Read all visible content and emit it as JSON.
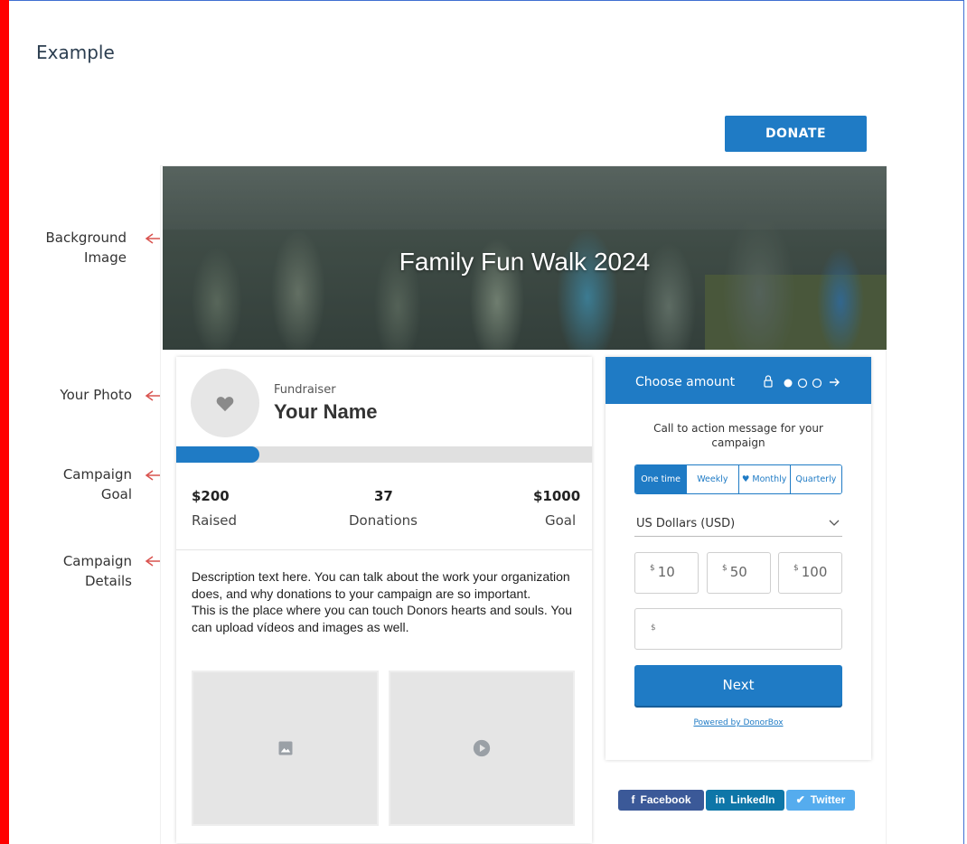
{
  "heading": "Example",
  "annotations": {
    "background_image": [
      "Background",
      "Image"
    ],
    "your_photo": [
      "Your Photo"
    ],
    "campaign_goal": [
      "Campaign",
      "Goal"
    ],
    "campaign_details": [
      "Campaign",
      "Details"
    ]
  },
  "topbar": {
    "donate_label": "DONATE"
  },
  "hero": {
    "title": "Family Fun Walk 2024"
  },
  "profile": {
    "role": "Fundraiser",
    "name": "Your Name",
    "progress_fraction": 0.2
  },
  "stats": [
    {
      "value": "$200",
      "label": "Raised"
    },
    {
      "value": "37",
      "label": "Donations"
    },
    {
      "value": "$1000",
      "label": "Goal"
    }
  ],
  "description": {
    "paragraph1": "Description text here. You can talk about the work your organization does, and why donations to your campaign are so important.",
    "paragraph2": "This is the place where you can touch Donors hearts and souls. You can upload vídeos and images as well."
  },
  "donation_form": {
    "header": "Choose amount",
    "cta": "Call to action message for your campaign",
    "frequencies": [
      "One time",
      "Weekly",
      "Monthly",
      "Quarterly"
    ],
    "active_frequency": "One time",
    "currency": "US Dollars (USD)",
    "currency_symbol": "$",
    "amounts": [
      "10",
      "50",
      "100"
    ],
    "custom_amount_prefix": "$",
    "next_label": "Next",
    "powered_by": "Powered by DonorBox"
  },
  "share": [
    {
      "icon": "f",
      "label": "Facebook",
      "color": "#3b5998"
    },
    {
      "icon": "in",
      "label": "LinkedIn",
      "color": "#0e76a8"
    },
    {
      "icon": "🐦",
      "label": "Twitter",
      "color": "#55acee"
    }
  ],
  "colors": {
    "accent": "#1f7bc5",
    "annotation_arrow": "#d9534f",
    "left_bar": "#ff0000",
    "frame_border": "#3f6fd1"
  }
}
